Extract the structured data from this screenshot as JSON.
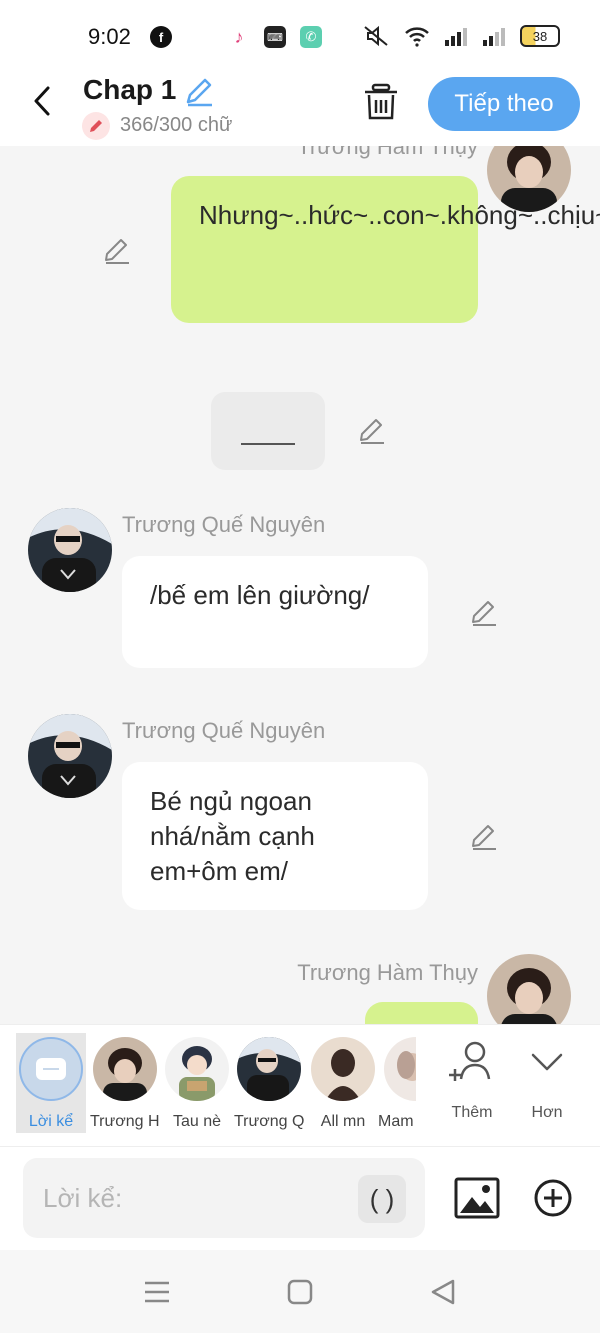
{
  "status_bar": {
    "time": "9:02",
    "battery": "38"
  },
  "header": {
    "title": "Chap 1",
    "word_count": "366/300 chữ",
    "next_label": "Tiếp theo"
  },
  "messages": [
    {
      "sender": "Trương Hàm Thụy",
      "text": "Nhưng~..hức~..con~.không~..chịu~..được~..",
      "side": "right",
      "color": "#d6f28e"
    },
    {
      "type": "narration",
      "text": ""
    },
    {
      "sender": "Trương Quế Nguyên",
      "text": "/bế em lên giường/",
      "side": "left"
    },
    {
      "sender": "Trương Quế Nguyên",
      "text": "Bé ngủ ngoan nhá/nằm cạnh em+ôm em/",
      "side": "left"
    },
    {
      "sender": "Trương Hàm Thụy",
      "text": "",
      "side": "right"
    }
  ],
  "characters": [
    {
      "label": "Lời kể",
      "icon": "narration-icon",
      "selected": true
    },
    {
      "label": "Trương H..."
    },
    {
      "label": "Tau nè"
    },
    {
      "label": "Trương Q..."
    },
    {
      "label": "All mn"
    },
    {
      "label": "Mam"
    }
  ],
  "actions": {
    "add_label": "Thêm",
    "more_label": "Hơn"
  },
  "input": {
    "placeholder": "Lời kể:",
    "paren_label": "( )"
  },
  "colors": {
    "accent": "#5aa6f0",
    "bubble_green": "#d6f28e",
    "bubble_white": "#ffffff",
    "background": "#f5f5f5"
  }
}
